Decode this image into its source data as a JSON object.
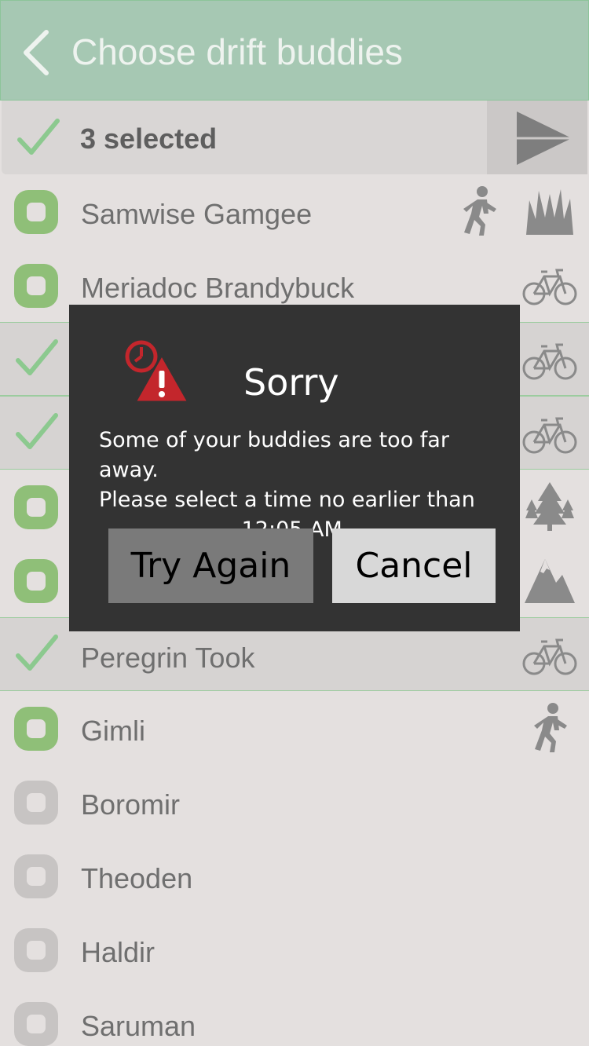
{
  "header": {
    "title": "Choose drift buddies",
    "back_icon": "chevron-left-icon"
  },
  "selection_bar": {
    "label": "3 selected",
    "send_icon": "send-icon"
  },
  "buddies": [
    {
      "name": "Samwise Gamgee",
      "state": "green",
      "icons": [
        "walker-icon",
        "grass-icon"
      ]
    },
    {
      "name": "Meriadoc Brandybuck",
      "state": "green",
      "icons": [
        "bicycle-icon"
      ]
    },
    {
      "name": "",
      "state": "selected",
      "icons": [
        "bicycle-icon"
      ]
    },
    {
      "name": "",
      "state": "selected",
      "icons": [
        "bicycle-icon"
      ]
    },
    {
      "name": "",
      "state": "green",
      "icons": [
        "trees-icon"
      ]
    },
    {
      "name": "",
      "state": "green",
      "icons": [
        "mountain-icon"
      ]
    },
    {
      "name": "Peregrin Took",
      "state": "selected",
      "icons": [
        "bicycle-icon"
      ]
    },
    {
      "name": "Gimli",
      "state": "green",
      "icons": [
        "walker-icon"
      ]
    },
    {
      "name": "Boromir",
      "state": "gray",
      "icons": []
    },
    {
      "name": "Theoden",
      "state": "gray",
      "icons": []
    },
    {
      "name": "Haldir",
      "state": "gray",
      "icons": []
    },
    {
      "name": "Saruman",
      "state": "gray",
      "icons": []
    }
  ],
  "dialog": {
    "title": "Sorry",
    "icon": "clock-warning-icon",
    "message_line1": "Some of your buddies are too far away.",
    "message_line2": "Please select a time no earlier than",
    "message_line3": "12:05 AM.",
    "try_again_label": "Try Again",
    "cancel_label": "Cancel"
  },
  "colors": {
    "header": "#a6c8b3",
    "check": "#8cc98f",
    "box_green": "#8fbf78",
    "box_gray": "#c7c4c3",
    "dialog_bg": "#333333",
    "warning_red": "#c3262c"
  }
}
